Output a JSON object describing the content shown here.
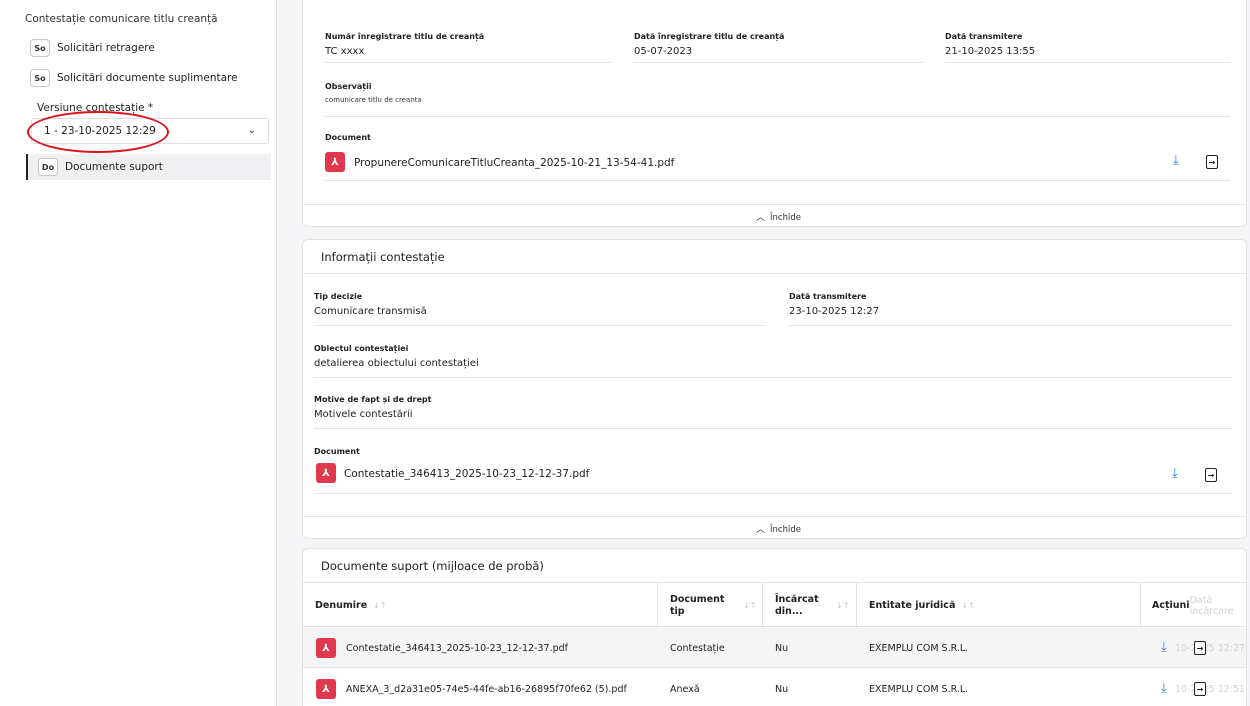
{
  "sidebar": {
    "title": "Contestație comunicare titlu creanță",
    "items": [
      {
        "badge": "So",
        "label": "Solicitări retragere"
      },
      {
        "badge": "So",
        "label": "Solicitări documente suplimentare"
      }
    ],
    "version_label": "Versiune contestație *",
    "version_value": "1 - 23-10-2025 12:29",
    "active_item": {
      "badge": "Do",
      "label": "Documente suport"
    }
  },
  "title_card": {
    "fields": [
      {
        "label": "Număr înregistrare titlu de creanță",
        "value": "TC xxxx"
      },
      {
        "label": "Dată înregistrare titlu de creanță",
        "value": "05-07-2023"
      },
      {
        "label": "Dată transmitere",
        "value": "21-10-2025 13:55"
      }
    ],
    "observations_label": "Observații",
    "observations_value": "comunicare titlu de creanta",
    "document_label": "Document",
    "document_name": "PropunereComunicareTitluCreanta_2025-10-21_13-54-41.pdf",
    "close_label": "Închide"
  },
  "contest_card": {
    "title": "Informații contestație",
    "decision_label": "Tip decizie",
    "decision_value": "Comunicare transmisă",
    "date_label": "Dată transmitere",
    "date_value": "23-10-2025 12:27",
    "object_label": "Obiectul contestației",
    "object_value": "detalierea obiectului contestației",
    "reasons_label": "Motive de fapt și de drept",
    "reasons_value": "Motivele contestării",
    "document_label": "Document",
    "document_name": "Contestatie_346413_2025-10-23_12-12-37.pdf",
    "close_label": "Închide"
  },
  "support_docs": {
    "title": "Documente suport (mijloace de probă)",
    "columns": [
      "Denumire",
      "Document tip",
      "Încărcat din...",
      "Entitate juridică",
      "Acțiuni"
    ],
    "hidden_column": "Dată încărcare",
    "rows": [
      {
        "name": "Contestatie_346413_2025-10-23_12-12-37.pdf",
        "type": "Contestație",
        "uploaded": "Nu",
        "entity": "EXEMPLU COM S.R.L.",
        "date_fragment": "10-2025 12:27"
      },
      {
        "name": "ANEXA_3_d2a31e05-74e5-44fe-ab16-26895f70fe62 (5).pdf",
        "type": "Anexă",
        "uploaded": "Nu",
        "entity": "EXEMPLU COM S.R.L.",
        "date_fragment": "10-2025 12:51"
      }
    ]
  },
  "colors": {
    "accent_red": "#d8141c",
    "pdf_red": "#e0394e",
    "download_blue": "#2b7be4"
  }
}
